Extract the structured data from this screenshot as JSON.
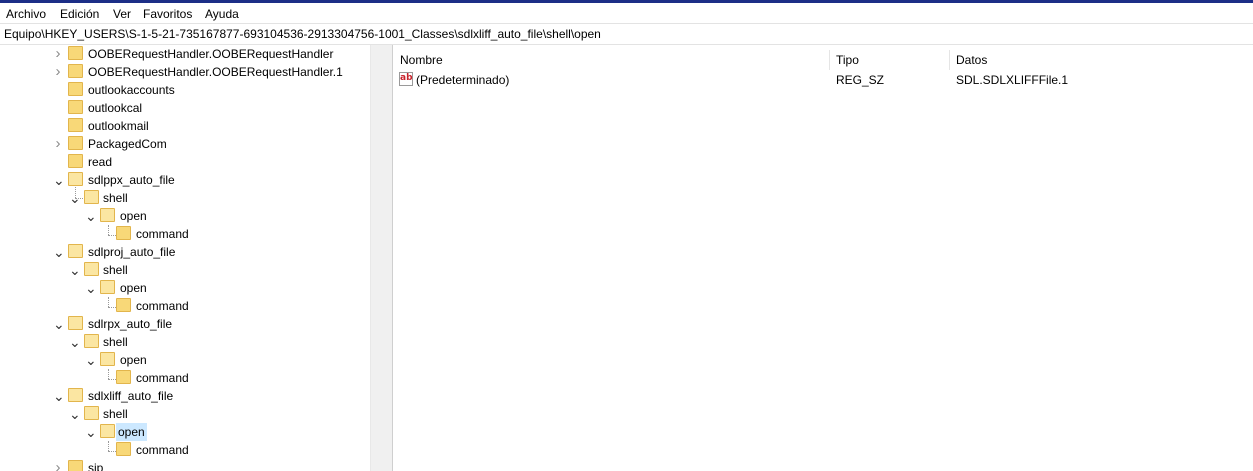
{
  "menu": {
    "items": [
      "Archivo",
      "Edición",
      "Ver",
      "Favoritos",
      "Ayuda"
    ]
  },
  "address": {
    "path": "Equipo\\HKEY_USERS\\S-1-5-21-735167877-693104536-2913304756-1001_Classes\\sdlxliff_auto_file\\shell\\open"
  },
  "tree": {
    "nodes": [
      {
        "label": "OOBERequestHandler.OOBERequestHandler",
        "expander": ">",
        "selected": false
      },
      {
        "label": "OOBERequestHandler.OOBERequestHandler.1",
        "expander": ">",
        "selected": false
      },
      {
        "label": "outlookaccounts",
        "expander": "",
        "selected": false
      },
      {
        "label": "outlookcal",
        "expander": "",
        "selected": false
      },
      {
        "label": "outlookmail",
        "expander": "",
        "selected": false
      },
      {
        "label": "PackagedCom",
        "expander": ">",
        "selected": false
      },
      {
        "label": "read",
        "expander": "",
        "selected": false
      },
      {
        "label": "sdlppx_auto_file",
        "expander": "v",
        "selected": false
      },
      {
        "label": "shell",
        "expander": "v",
        "selected": false
      },
      {
        "label": "open",
        "expander": "v",
        "selected": false
      },
      {
        "label": "command",
        "expander": "",
        "selected": false
      },
      {
        "label": "sdlproj_auto_file",
        "expander": "v",
        "selected": false
      },
      {
        "label": "shell",
        "expander": "v",
        "selected": false
      },
      {
        "label": "open",
        "expander": "v",
        "selected": false
      },
      {
        "label": "command",
        "expander": "",
        "selected": false
      },
      {
        "label": "sdlrpx_auto_file",
        "expander": "v",
        "selected": false
      },
      {
        "label": "shell",
        "expander": "v",
        "selected": false
      },
      {
        "label": "open",
        "expander": "v",
        "selected": false
      },
      {
        "label": "command",
        "expander": "",
        "selected": false
      },
      {
        "label": "sdlxliff_auto_file",
        "expander": "v",
        "selected": false
      },
      {
        "label": "shell",
        "expander": "v",
        "selected": false
      },
      {
        "label": "open",
        "expander": "v",
        "selected": true
      },
      {
        "label": "command",
        "expander": "",
        "selected": false
      },
      {
        "label": "sip",
        "expander": ">",
        "selected": false
      }
    ]
  },
  "list": {
    "headers": {
      "name": "Nombre",
      "type": "Tipo",
      "data": "Datos"
    },
    "rows": [
      {
        "icon": "string-value-icon",
        "icon_text": "ab",
        "name": "(Predeterminado)",
        "type": "REG_SZ",
        "data": "SDL.SDLXLIFFFile.1"
      }
    ]
  },
  "colors": {
    "selection": "#cce8ff",
    "folder": "#f8d878",
    "title_accent": "#1c2e87"
  }
}
